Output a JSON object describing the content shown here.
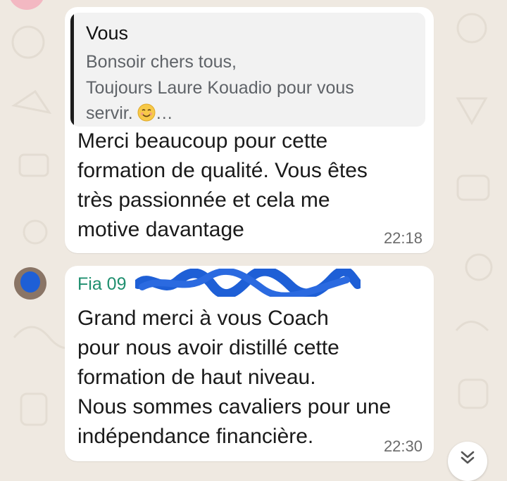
{
  "chat": {
    "messages": [
      {
        "quote": {
          "author": "Vous",
          "lines": [
            "Bonsoir chers tous,",
            "Toujours Laure Kouadio pour vous",
            "servir."
          ],
          "truncation": "…"
        },
        "lines": [
          "Merci beaucoup pour cette",
          "formation de qualité. Vous êtes",
          "très passionnée et cela me",
          "motive davantage"
        ],
        "time": "22:18"
      },
      {
        "sender": "Fia 09",
        "lines": [
          "Grand merci à vous Coach",
          "pour nous avoir distillé cette",
          "formation de haut niveau.",
          "Nous sommes cavaliers pour une",
          "indépendance financière."
        ],
        "time": "22:30"
      }
    ]
  },
  "icons": {
    "quote_emoji": "smiling-face-emoji",
    "scroll": "double-chevron-down-icon"
  },
  "colors": {
    "background": "#efe9e1",
    "bubble": "#ffffff",
    "sender_name": "#1f8f6f",
    "redaction": "#1e5fd6"
  }
}
